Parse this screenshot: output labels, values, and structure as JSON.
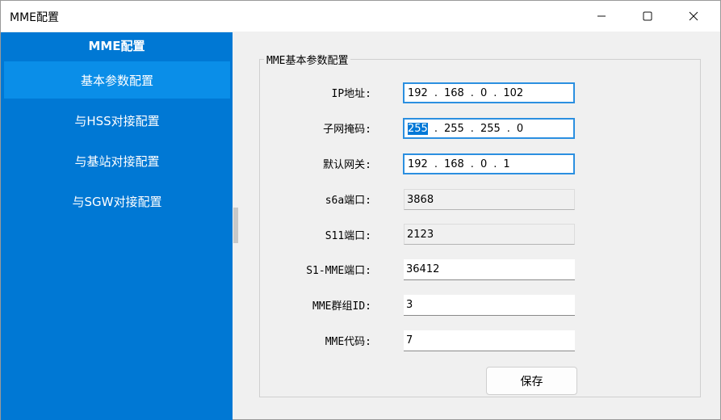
{
  "window": {
    "title": "MME配置"
  },
  "sidebar": {
    "title": "MME配置",
    "items": [
      {
        "label": "基本参数配置"
      },
      {
        "label": "与HSS对接配置"
      },
      {
        "label": "与基站对接配置"
      },
      {
        "label": "与SGW对接配置"
      }
    ],
    "active_index": 0
  },
  "form": {
    "group_title": "MME基本参数配置",
    "ip_address": {
      "label": "IP地址:",
      "octets": [
        "192",
        "168",
        "0",
        "102"
      ]
    },
    "subnet_mask": {
      "label": "子网掩码:",
      "octets": [
        "255",
        "255",
        "255",
        "0"
      ]
    },
    "gateway": {
      "label": "默认网关:",
      "octets": [
        "192",
        "168",
        "0",
        "1"
      ]
    },
    "s6a_port": {
      "label": "s6a端口:",
      "value": "3868"
    },
    "s11_port": {
      "label": "S11端口:",
      "value": "2123"
    },
    "s1_mme_port": {
      "label": "S1-MME端口:",
      "value": "36412"
    },
    "mme_group_id": {
      "label": "MME群组ID:",
      "value": "3"
    },
    "mme_code": {
      "label": "MME代码:",
      "value": "7"
    },
    "save_label": "保存"
  },
  "colors": {
    "sidebar_bg": "#0078d4",
    "sidebar_active": "#0a8ee8",
    "field_focus_border": "#2b8fe0",
    "selection": "#0078d7"
  },
  "icons": {
    "minimize": "minimize-icon",
    "maximize": "maximize-icon",
    "close": "close-icon"
  }
}
